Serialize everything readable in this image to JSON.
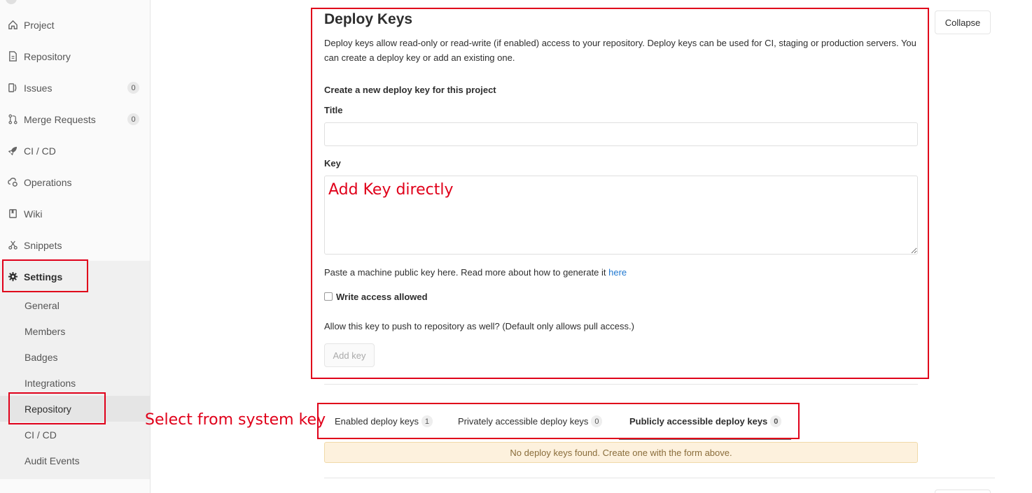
{
  "sidebar": {
    "items": [
      {
        "label": "Project",
        "icon": "home-icon"
      },
      {
        "label": "Repository",
        "icon": "doc-icon"
      },
      {
        "label": "Issues",
        "icon": "issues-icon",
        "count": "0"
      },
      {
        "label": "Merge Requests",
        "icon": "merge-icon",
        "count": "0"
      },
      {
        "label": "CI / CD",
        "icon": "rocket-icon"
      },
      {
        "label": "Operations",
        "icon": "cloud-gear-icon"
      },
      {
        "label": "Wiki",
        "icon": "book-icon"
      },
      {
        "label": "Snippets",
        "icon": "scissors-icon"
      },
      {
        "label": "Settings",
        "icon": "gear-icon"
      }
    ],
    "settings_sub": [
      "General",
      "Members",
      "Badges",
      "Integrations",
      "Repository",
      "CI / CD",
      "Audit Events"
    ]
  },
  "deploy": {
    "title": "Deploy Keys",
    "description": "Deploy keys allow read-only or read-write (if enabled) access to your repository. Deploy keys can be used for CI, staging or production servers. You can create a deploy key or add an existing one.",
    "collapse_label": "Collapse",
    "create_heading": "Create a new deploy key for this project",
    "title_label": "Title",
    "title_value": "",
    "key_label": "Key",
    "key_value": "",
    "help_text": "Paste a machine public key here. Read more about how to generate it ",
    "help_link": "here",
    "write_access_label": "Write access allowed",
    "write_access_checked": false,
    "write_help": "Allow this key to push to repository as well? (Default only allows pull access.)",
    "add_key_label": "Add key"
  },
  "tabs": [
    {
      "label": "Enabled deploy keys",
      "count": "1"
    },
    {
      "label": "Privately accessible deploy keys",
      "count": "0"
    },
    {
      "label": "Publicly accessible deploy keys",
      "count": "0"
    }
  ],
  "empty_message": "No deploy keys found. Create one with the form above.",
  "annotations": {
    "add_key_directly": "Add Key directly",
    "select_from_system": "Select from system key"
  },
  "colors": {
    "annotation_red": "#e0001a",
    "link_blue": "#1f78d1",
    "warning_bg": "#fdf1dd"
  }
}
